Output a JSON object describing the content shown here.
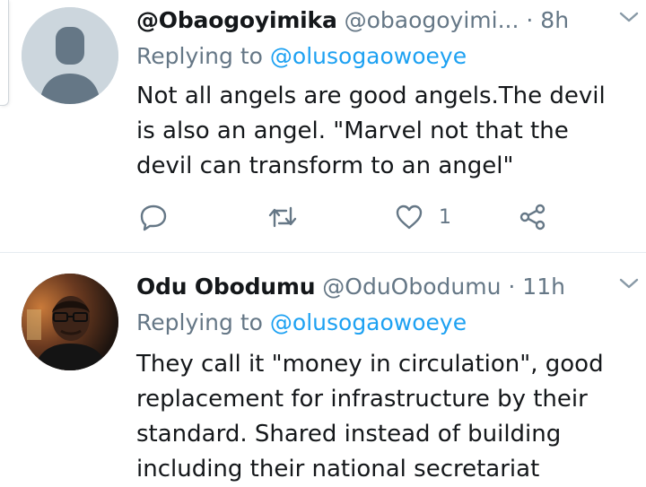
{
  "tweets": [
    {
      "display_name": "@Obaogoyimika",
      "handle": "@obaogoyimi...",
      "time": "· 8h",
      "replying_label": "Replying to",
      "replying_to": "@olusogaowoeye",
      "text_lines": [
        "Not all angels are good angels.The devil",
        "is also an angel. \"Marvel not that the",
        "devil can transform to an angel\""
      ],
      "like_count": "1",
      "avatar": "default-avatar-icon"
    },
    {
      "display_name": "Odu Obodumu",
      "handle": "@OduObodumu",
      "time": "· 11h",
      "replying_label": "Replying to",
      "replying_to": "@olusogaowoeye",
      "text_lines": [
        "They call it \"money in circulation\", good",
        "replacement for infrastructure by their",
        "standard. Shared instead of building",
        "including their national secretariat"
      ],
      "avatar": "profile-photo"
    }
  ],
  "icons": [
    "reply-icon",
    "retweet-icon",
    "heart-icon",
    "share-icon",
    "chevron-down-icon"
  ],
  "colors": {
    "text": "#14171a",
    "secondary": "#657786",
    "link": "#1da1f2",
    "divider": "#e6ecf0"
  }
}
